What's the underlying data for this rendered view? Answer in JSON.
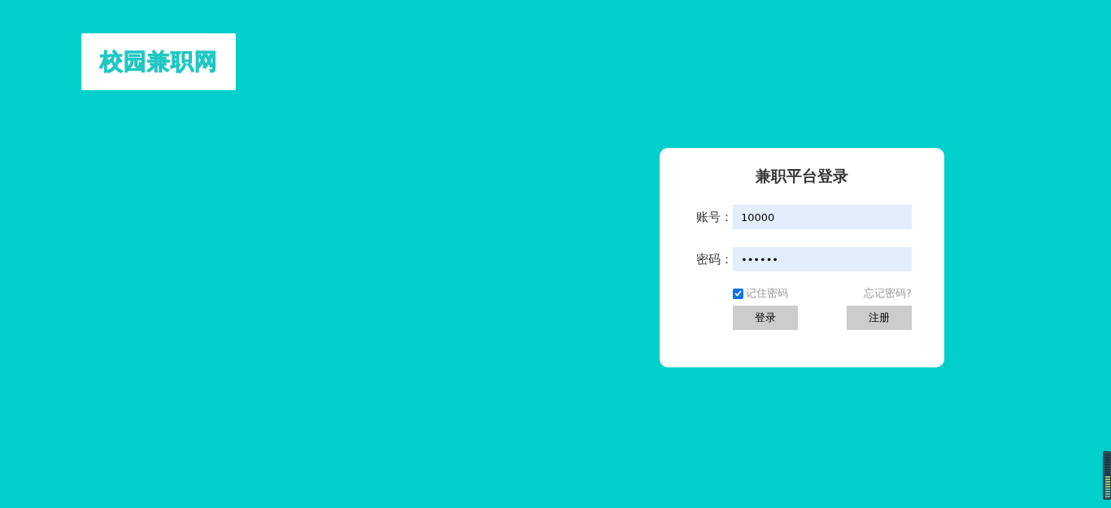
{
  "logo": {
    "text": "校园兼职网"
  },
  "login": {
    "title": "兼职平台登录",
    "fields": [
      {
        "label": "账号：",
        "value": "10000"
      },
      {
        "label": "密码：",
        "value": "••••••"
      }
    ],
    "remember": {
      "label": "记住密码",
      "checked": true
    },
    "forgot": "忘记密码?",
    "buttons": [
      "登录",
      "注册"
    ]
  }
}
